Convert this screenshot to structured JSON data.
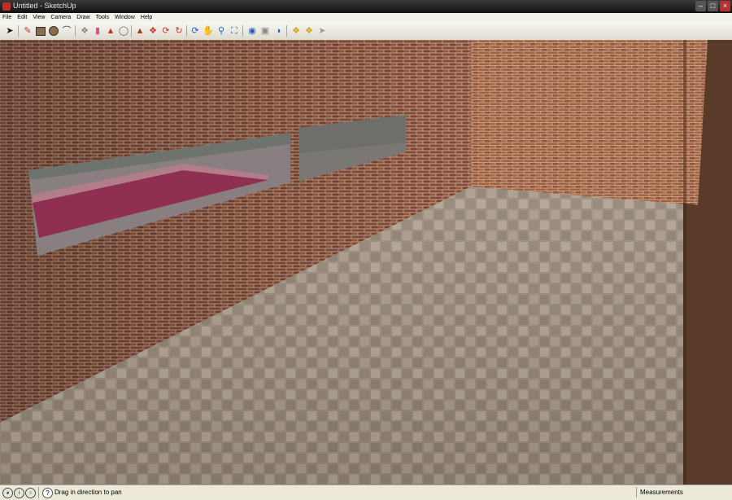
{
  "window": {
    "title": "Untitled - SketchUp"
  },
  "menu": [
    "File",
    "Edit",
    "View",
    "Camera",
    "Draw",
    "Tools",
    "Window",
    "Help"
  ],
  "toolbar": [
    "select-icon",
    "line-icon",
    "pencil-icon",
    "rectangle-icon",
    "circle-icon",
    "arc-icon",
    "make-component-icon",
    "eraser-icon",
    "paint-bucket-icon",
    "tape-measure-icon",
    "push-pull-icon",
    "follow-me-icon",
    "move-icon",
    "rotate-icon",
    "offset-icon",
    "orbit-icon",
    "pan-icon",
    "zoom-icon",
    "zoom-extents-icon",
    "photo-textures-icon",
    "get-models-icon",
    "share-model-icon",
    "components-icon",
    "extension-warehouse-icon",
    "layout-icon"
  ],
  "status": {
    "hint": "Drag in direction to pan",
    "measurements_label": "Measurements"
  },
  "scene": {
    "wall_color": "#8b4a35",
    "floor_color": "#9a8b7b",
    "mortar_color": "#b9a795",
    "window_fill_color": "#8a6a74",
    "pool_color": "#8f2f52"
  }
}
